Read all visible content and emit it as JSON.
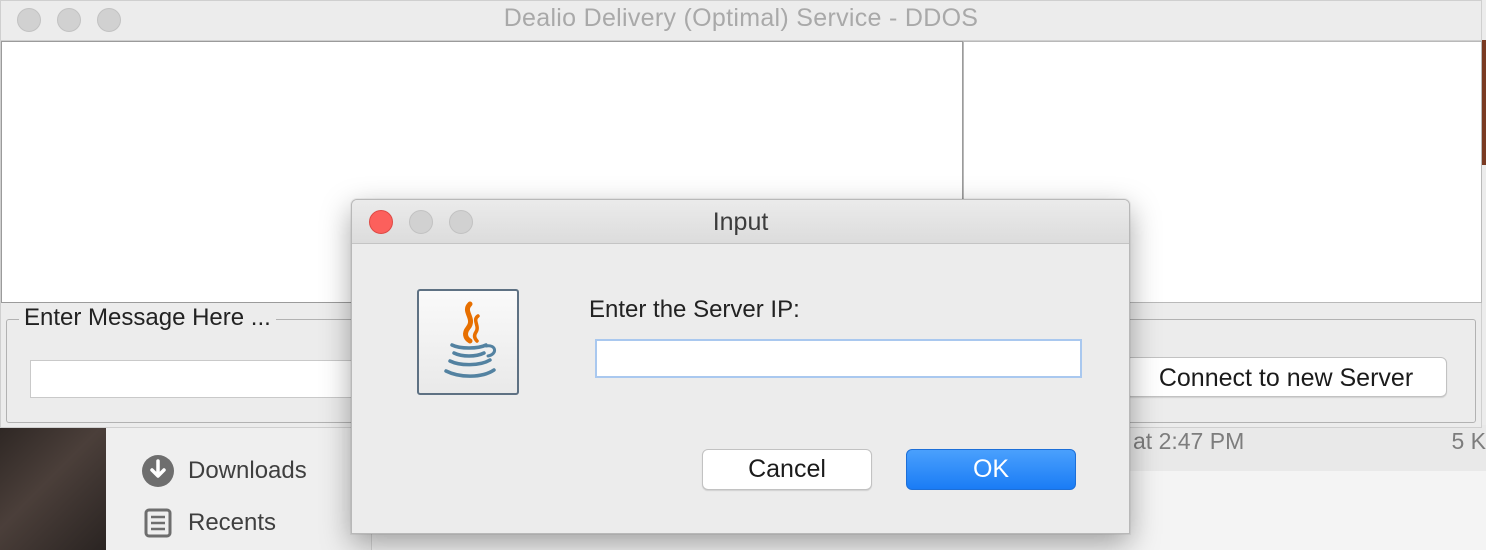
{
  "colors": {
    "close": "#fc605c",
    "ok_button": "#1a7cf5",
    "window_bg": "#ececec"
  },
  "main_window": {
    "title": "Dealio Delivery (Optimal) Service - DDOS",
    "message_group_label": "Enter Message Here ...",
    "message_input_value": "",
    "connect_button": "Connect to new Server"
  },
  "dialog": {
    "title": "Input",
    "icon": "java-icon",
    "prompt": "Enter the Server IP:",
    "input_value": "",
    "cancel_label": "Cancel",
    "ok_label": "OK"
  },
  "background": {
    "sidebar_items": [
      {
        "label": "Downloads",
        "icon": "download-icon"
      },
      {
        "label": "Recents",
        "icon": "recents-icon"
      }
    ],
    "file_row": {
      "date": "at 2:47 PM",
      "size": "5 K"
    }
  }
}
